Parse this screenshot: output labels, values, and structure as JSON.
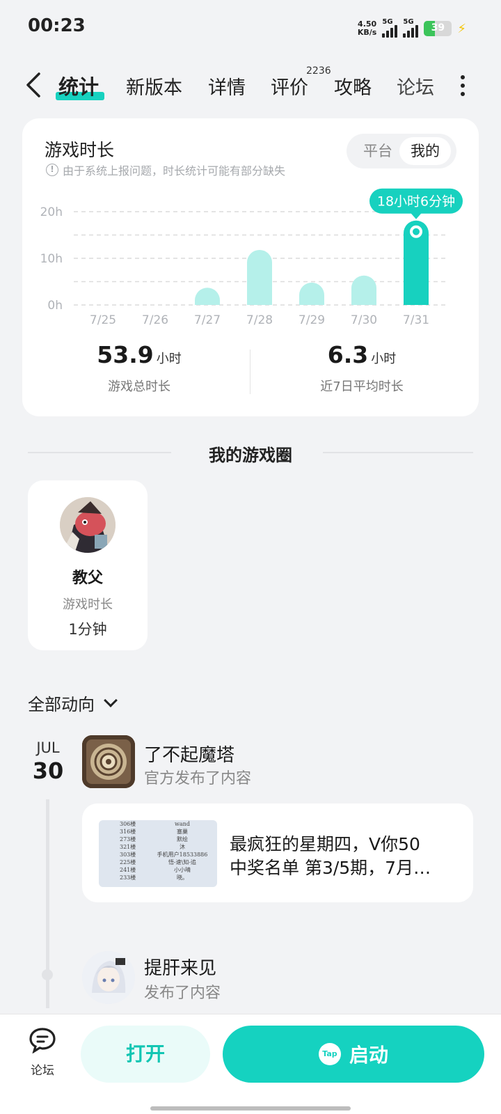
{
  "status_bar": {
    "time": "00:23",
    "net_speed_value": "4.50",
    "net_speed_unit": "KB/s",
    "sim1": "5G",
    "sim2": "5G",
    "battery": "39",
    "battery_level": 0.39
  },
  "tabs": [
    {
      "label": "统计",
      "active": true
    },
    {
      "label": "新版本"
    },
    {
      "label": "详情"
    },
    {
      "label": "评价",
      "badge": "2236"
    },
    {
      "label": "攻略"
    },
    {
      "label": "论坛"
    }
  ],
  "play_card": {
    "title": "游戏时长",
    "note": "由于系统上报问题，时长统计可能有部分缺失",
    "toggle": {
      "platform": "平台",
      "mine": "我的"
    },
    "tooltip": "18小时6分钟",
    "stats": {
      "total_value": "53.9",
      "total_unit": "小时",
      "total_label": "游戏总时长",
      "avg_value": "6.3",
      "avg_unit": "小时",
      "avg_label": "近7日平均时长"
    }
  },
  "chart_data": {
    "type": "bar",
    "categories": [
      "7/25",
      "7/26",
      "7/27",
      "7/28",
      "7/29",
      "7/30",
      "7/31"
    ],
    "values": [
      0,
      0,
      3.7,
      11.8,
      4.8,
      6.3,
      18.1
    ],
    "y_ticks": [
      "0h",
      "10h",
      "20h"
    ],
    "ylim": [
      0,
      20
    ],
    "highlight_index": 6,
    "colors": {
      "bar": "#b5f0ea",
      "highlight": "#17d1bf"
    },
    "grid": "dashed"
  },
  "circle": {
    "section_title": "我的游戏圈",
    "friend": {
      "name": "教父",
      "label": "游戏时长",
      "value": "1分钟"
    }
  },
  "feed": {
    "filter": "全部动向",
    "date_month": "JUL",
    "date_day": "30",
    "post1": {
      "author": "了不起魔塔",
      "action": "官方发布了内容",
      "text_line1": "最疯狂的星期四，V你50",
      "text_line2": "中奖名单 第3/5期，7月…",
      "thumb_rows": [
        [
          "306楼",
          "wand"
        ],
        [
          "316楼",
          "塞巢"
        ],
        [
          "273楼",
          "默绘"
        ],
        [
          "321楼",
          "沐"
        ],
        [
          "303楼",
          "手机用户18533886"
        ],
        [
          "225楼",
          "悟-速\\知-追"
        ],
        [
          "241楼",
          "小小晴"
        ],
        [
          "233楼",
          "晓。"
        ]
      ]
    },
    "post2": {
      "author": "提肝来见",
      "action": "发布了内容"
    }
  },
  "bottom_bar": {
    "forum_label": "论坛",
    "open_label": "打开",
    "launch_label": "启动",
    "tap_logo": "Tap"
  }
}
